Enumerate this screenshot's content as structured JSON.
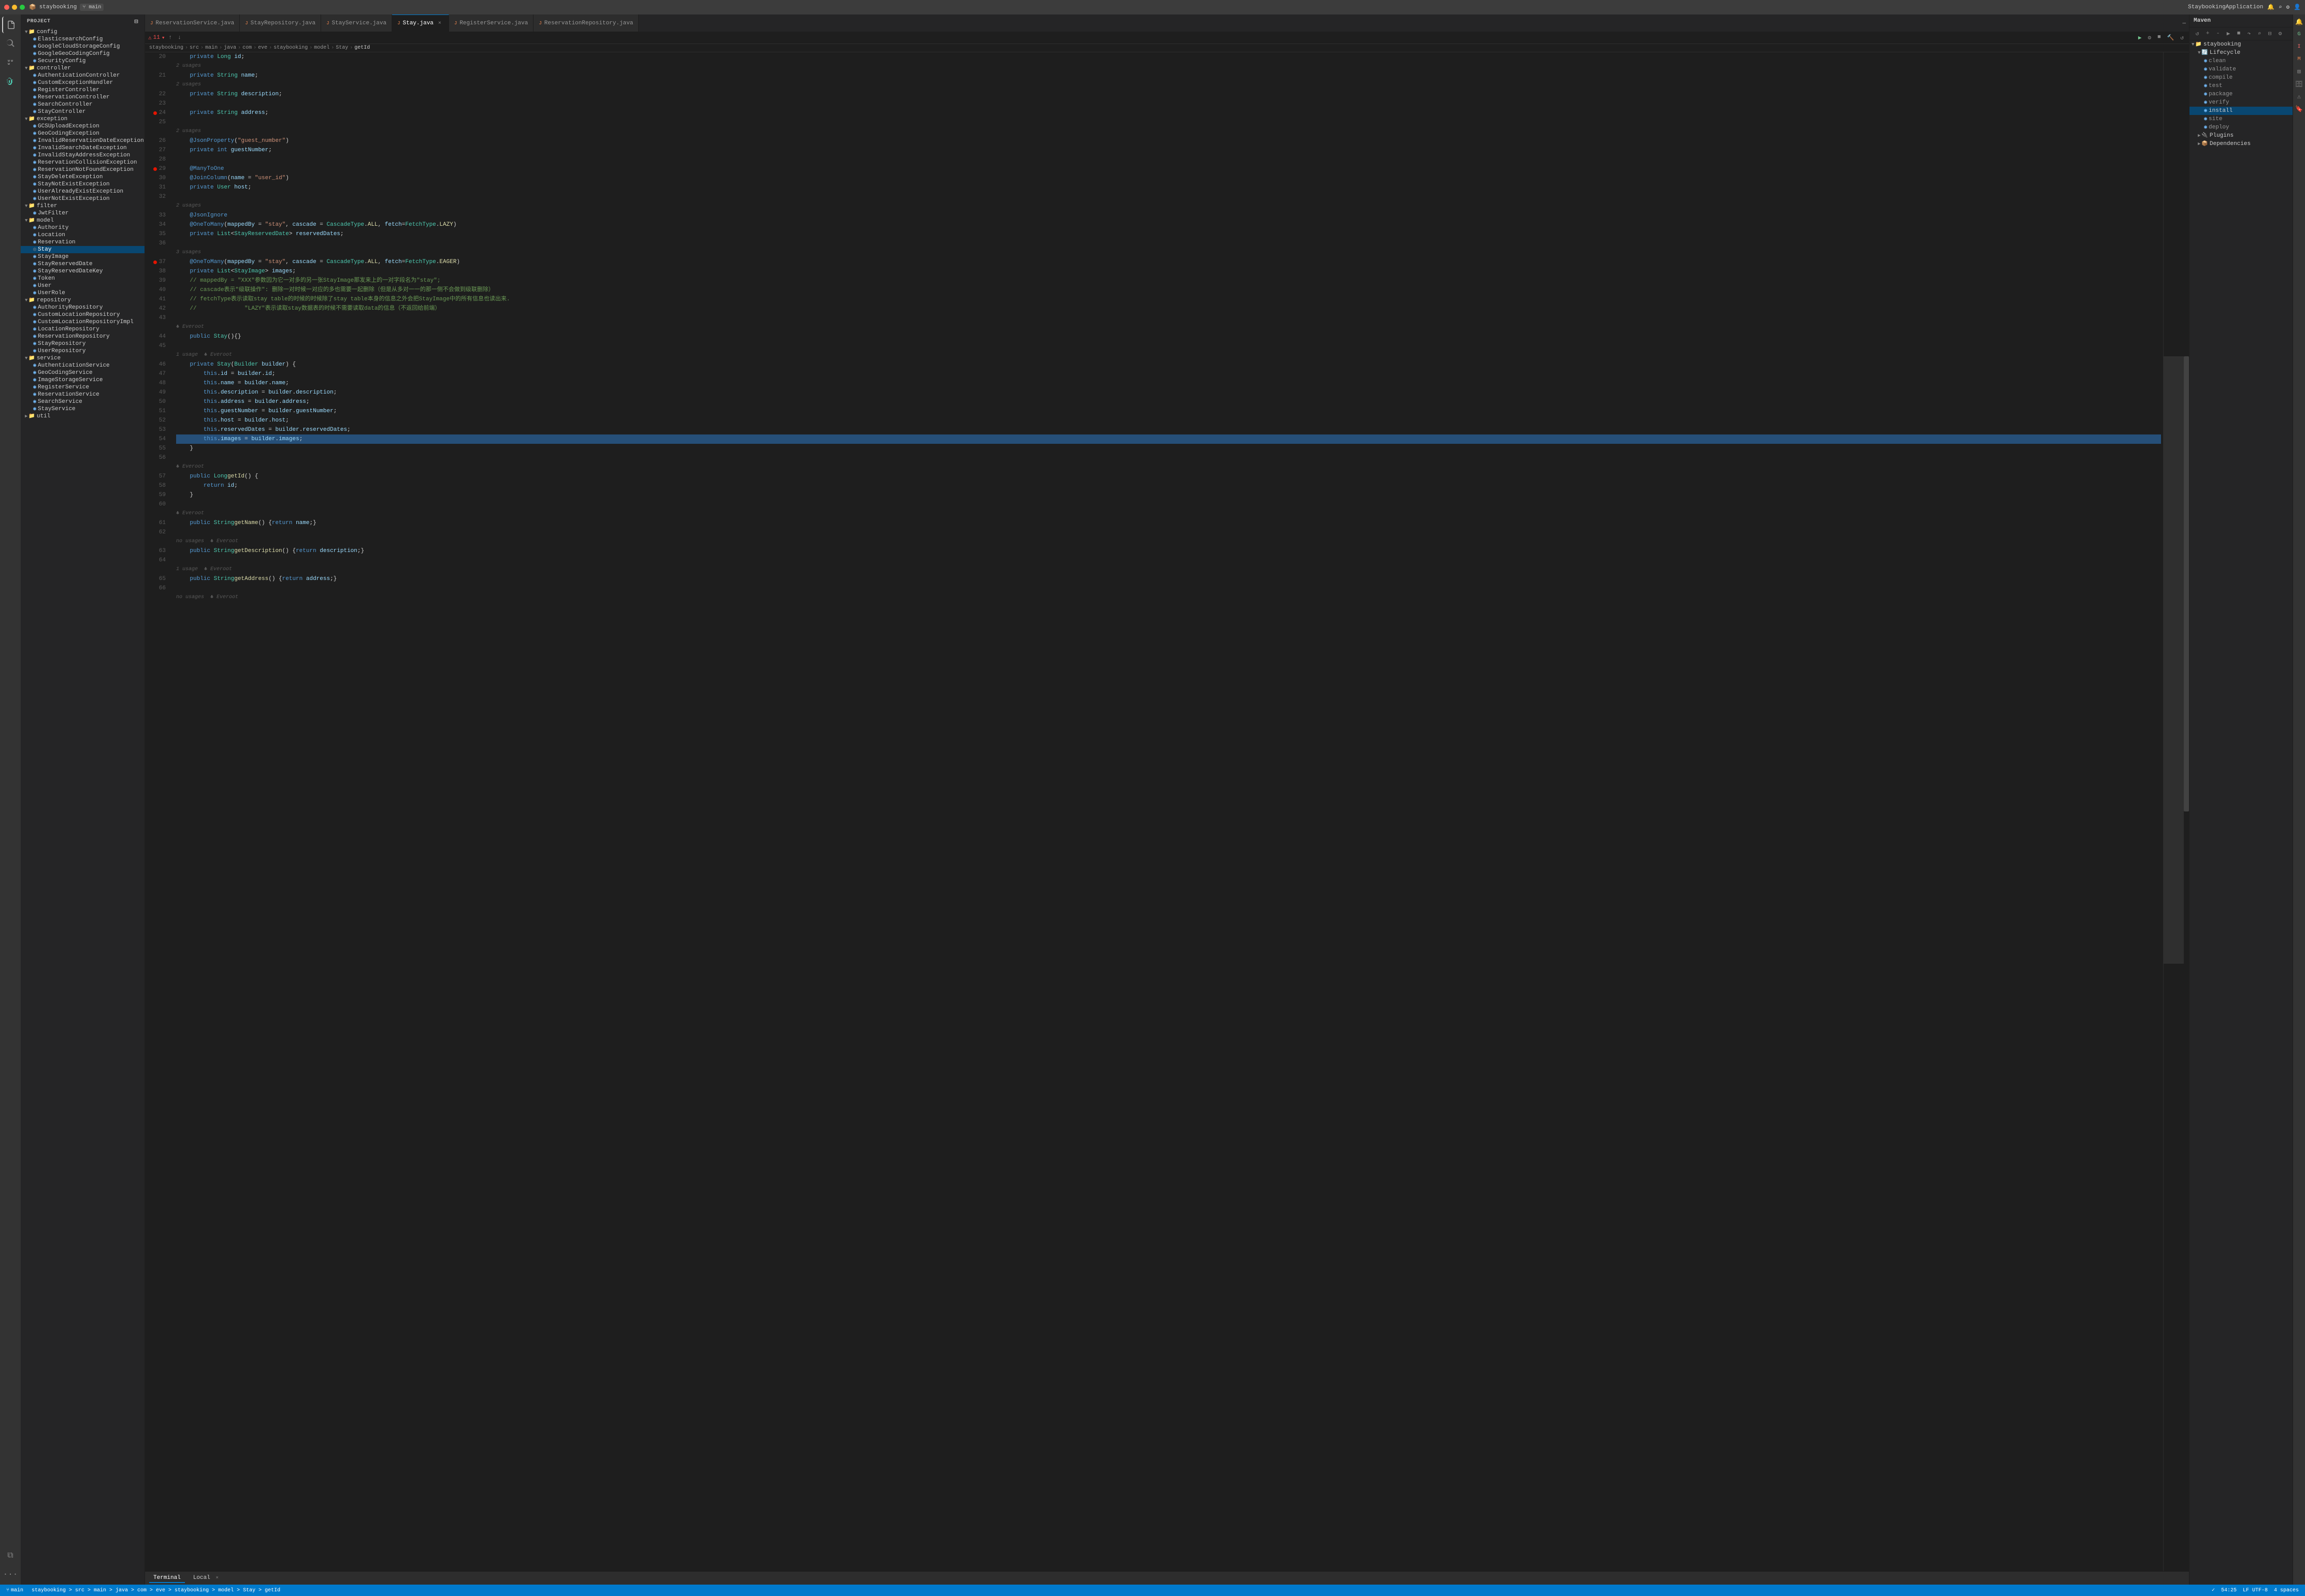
{
  "titleBar": {
    "appName": "StaybookingApplication",
    "project": "staybooking",
    "branch": "main"
  },
  "tabs": [
    {
      "label": "ReservationService.java",
      "active": false,
      "modified": false
    },
    {
      "label": "StayRepository.java",
      "active": false,
      "modified": false
    },
    {
      "label": "StayService.java",
      "active": false,
      "modified": false
    },
    {
      "label": "Stay.java",
      "active": true,
      "modified": false
    },
    {
      "label": "RegisterService.java",
      "active": false,
      "modified": false
    },
    {
      "label": "ReservationRepository.java",
      "active": false,
      "modified": false
    }
  ],
  "sidebar": {
    "title": "Project",
    "tree": [
      {
        "label": "config",
        "type": "folder",
        "depth": 1,
        "expanded": true
      },
      {
        "label": "ElasticsearchConfig",
        "type": "file",
        "depth": 2
      },
      {
        "label": "GoogleCloudStorageConfig",
        "type": "file",
        "depth": 2
      },
      {
        "label": "GoogleGeoCodingConfig",
        "type": "file",
        "depth": 2
      },
      {
        "label": "SecurityConfig",
        "type": "file",
        "depth": 2
      },
      {
        "label": "controller",
        "type": "folder",
        "depth": 1,
        "expanded": true
      },
      {
        "label": "AuthenticationController",
        "type": "file",
        "depth": 2
      },
      {
        "label": "CustomExceptionHandler",
        "type": "file",
        "depth": 2
      },
      {
        "label": "RegisterController",
        "type": "file",
        "depth": 2
      },
      {
        "label": "ReservationController",
        "type": "file",
        "depth": 2
      },
      {
        "label": "SearchController",
        "type": "file",
        "depth": 2
      },
      {
        "label": "StayController",
        "type": "file",
        "depth": 2
      },
      {
        "label": "exception",
        "type": "folder",
        "depth": 1,
        "expanded": true
      },
      {
        "label": "GCSUploadException",
        "type": "file",
        "depth": 2
      },
      {
        "label": "GeoCodingException",
        "type": "file",
        "depth": 2
      },
      {
        "label": "InvalidReservationDateException",
        "type": "file",
        "depth": 2
      },
      {
        "label": "InvalidSearchDateException",
        "type": "file",
        "depth": 2
      },
      {
        "label": "InvalidStayAddressException",
        "type": "file",
        "depth": 2
      },
      {
        "label": "ReservationCollisionException",
        "type": "file",
        "depth": 2
      },
      {
        "label": "ReservationNotFoundException",
        "type": "file",
        "depth": 2
      },
      {
        "label": "StayDeleteException",
        "type": "file",
        "depth": 2
      },
      {
        "label": "StayNotExistException",
        "type": "file",
        "depth": 2
      },
      {
        "label": "UserAlreadyExistException",
        "type": "file",
        "depth": 2
      },
      {
        "label": "UserNotExistException",
        "type": "file",
        "depth": 2
      },
      {
        "label": "filter",
        "type": "folder",
        "depth": 1,
        "expanded": true
      },
      {
        "label": "JwtFilter",
        "type": "file",
        "depth": 2
      },
      {
        "label": "model",
        "type": "folder",
        "depth": 1,
        "expanded": true
      },
      {
        "label": "Authority",
        "type": "file",
        "depth": 2
      },
      {
        "label": "Location",
        "type": "file",
        "depth": 2
      },
      {
        "label": "Reservation",
        "type": "file",
        "depth": 2
      },
      {
        "label": "Stay",
        "type": "file",
        "depth": 2,
        "selected": true
      },
      {
        "label": "StayImage",
        "type": "file",
        "depth": 2
      },
      {
        "label": "StayReservedDate",
        "type": "file",
        "depth": 2
      },
      {
        "label": "StayReservedDateKey",
        "type": "file",
        "depth": 2
      },
      {
        "label": "Token",
        "type": "file",
        "depth": 2
      },
      {
        "label": "User",
        "type": "file",
        "depth": 2
      },
      {
        "label": "UserRole",
        "type": "file",
        "depth": 2
      },
      {
        "label": "repository",
        "type": "folder",
        "depth": 1,
        "expanded": true
      },
      {
        "label": "AuthorityRepository",
        "type": "file",
        "depth": 2
      },
      {
        "label": "CustomLocationRepository",
        "type": "file",
        "depth": 2
      },
      {
        "label": "CustomLocationRepositoryImpl",
        "type": "file",
        "depth": 2
      },
      {
        "label": "LocationRepository",
        "type": "file",
        "depth": 2
      },
      {
        "label": "ReservationRepository",
        "type": "file",
        "depth": 2
      },
      {
        "label": "StayRepository",
        "type": "file",
        "depth": 2
      },
      {
        "label": "UserRepository",
        "type": "file",
        "depth": 2
      },
      {
        "label": "service",
        "type": "folder",
        "depth": 1,
        "expanded": true
      },
      {
        "label": "AuthenticationService",
        "type": "file",
        "depth": 2
      },
      {
        "label": "GeoCodingService",
        "type": "file",
        "depth": 2
      },
      {
        "label": "ImageStorageService",
        "type": "file",
        "depth": 2
      },
      {
        "label": "RegisterService",
        "type": "file",
        "depth": 2
      },
      {
        "label": "ReservationService",
        "type": "file",
        "depth": 2
      },
      {
        "label": "SearchService",
        "type": "file",
        "depth": 2
      },
      {
        "label": "StayService",
        "type": "file",
        "depth": 2
      },
      {
        "label": "util",
        "type": "folder",
        "depth": 1,
        "expanded": false
      }
    ]
  },
  "maven": {
    "title": "Maven",
    "tree": [
      {
        "label": "staybooking",
        "type": "folder",
        "depth": 0,
        "expanded": true
      },
      {
        "label": "Lifecycle",
        "type": "folder",
        "depth": 1,
        "expanded": true
      },
      {
        "label": "clean",
        "type": "leaf",
        "depth": 2
      },
      {
        "label": "validate",
        "type": "leaf",
        "depth": 2
      },
      {
        "label": "compile",
        "type": "leaf",
        "depth": 2
      },
      {
        "label": "test",
        "type": "leaf",
        "depth": 2
      },
      {
        "label": "package",
        "type": "leaf",
        "depth": 2
      },
      {
        "label": "verify",
        "type": "leaf",
        "depth": 2
      },
      {
        "label": "install",
        "type": "leaf",
        "depth": 2,
        "selected": true
      },
      {
        "label": "site",
        "type": "leaf",
        "depth": 2
      },
      {
        "label": "deploy",
        "type": "leaf",
        "depth": 2
      },
      {
        "label": "Plugins",
        "type": "folder",
        "depth": 1,
        "expanded": false
      },
      {
        "label": "Dependencies",
        "type": "folder",
        "depth": 1,
        "expanded": false
      }
    ]
  },
  "codeLines": [
    {
      "num": 20,
      "usages": "",
      "breakpoint": false,
      "code": "    private Long id;"
    },
    {
      "num": "",
      "usages": "2 usages",
      "breakpoint": false,
      "code": ""
    },
    {
      "num": 21,
      "usages": "",
      "breakpoint": false,
      "code": "    private String name;"
    },
    {
      "num": "",
      "usages": "2 usages",
      "breakpoint": false,
      "code": ""
    },
    {
      "num": 22,
      "usages": "",
      "breakpoint": false,
      "code": "    private String description;"
    },
    {
      "num": 23,
      "usages": "",
      "breakpoint": false,
      "code": ""
    },
    {
      "num": 24,
      "usages": "",
      "breakpoint": true,
      "code": "    private String address;"
    },
    {
      "num": 25,
      "usages": "",
      "breakpoint": false,
      "code": ""
    },
    {
      "num": "",
      "usages": "2 usages",
      "breakpoint": false,
      "code": ""
    },
    {
      "num": 26,
      "usages": "",
      "breakpoint": false,
      "code": "    @JsonProperty(\"guest_number\")"
    },
    {
      "num": 27,
      "usages": "",
      "breakpoint": false,
      "code": "    private int guestNumber;"
    },
    {
      "num": 28,
      "usages": "",
      "breakpoint": false,
      "code": ""
    },
    {
      "num": 29,
      "usages": "",
      "breakpoint": true,
      "code": "    @ManyToOne"
    },
    {
      "num": 30,
      "usages": "",
      "breakpoint": false,
      "code": "    @JoinColumn(name = \"user_id\")"
    },
    {
      "num": 31,
      "usages": "",
      "breakpoint": false,
      "code": "    private User host;"
    },
    {
      "num": 32,
      "usages": "",
      "breakpoint": false,
      "code": ""
    },
    {
      "num": "",
      "usages": "2 usages",
      "breakpoint": false,
      "code": ""
    },
    {
      "num": 33,
      "usages": "",
      "breakpoint": false,
      "code": "    @JsonIgnore"
    },
    {
      "num": 34,
      "usages": "",
      "breakpoint": false,
      "code": "    @OneToMany(mappedBy = \"stay\", cascade = CascadeType.ALL, fetch=FetchType.LAZY)"
    },
    {
      "num": 35,
      "usages": "",
      "breakpoint": false,
      "code": "    private List<StayReservedDate> reservedDates;"
    },
    {
      "num": 36,
      "usages": "",
      "breakpoint": false,
      "code": ""
    },
    {
      "num": "",
      "usages": "3 usages",
      "breakpoint": false,
      "code": ""
    },
    {
      "num": 37,
      "usages": "",
      "breakpoint": true,
      "code": "    @OneToMany(mappedBy = \"stay\", cascade = CascadeType.ALL, fetch=FetchType.EAGER)"
    },
    {
      "num": 38,
      "usages": "",
      "breakpoint": false,
      "code": "    private List<StayImage> images;"
    },
    {
      "num": 39,
      "usages": "",
      "breakpoint": false,
      "code": "    // mappedBy = \"XXX\"参数因为它一对多的另一张StayImage那发来上的一对字段名为\"stay\";"
    },
    {
      "num": 40,
      "usages": "",
      "breakpoint": false,
      "code": "    // cascade表示\"级联操作\": 删除一对时候一对应的多也需要一起删除（但是从多对一一的那一侧不会做到级联删除）"
    },
    {
      "num": 41,
      "usages": "",
      "breakpoint": false,
      "code": "    // fetchType表示读取stay table的时候的时候除了stay table本身的信息之外会把StayImage中的所有信息也读出来."
    },
    {
      "num": 42,
      "usages": "",
      "breakpoint": false,
      "code": "    //              \"LAZY\"表示读取stay数据表的时候不需要读取data的信息（不返回给前端）"
    },
    {
      "num": 43,
      "usages": "",
      "breakpoint": false,
      "code": ""
    },
    {
      "num": "",
      "usages": "♣ Everoot",
      "breakpoint": false,
      "code": ""
    },
    {
      "num": 44,
      "usages": "",
      "breakpoint": false,
      "code": "    public Stay(){}"
    },
    {
      "num": 45,
      "usages": "",
      "breakpoint": false,
      "code": ""
    },
    {
      "num": "",
      "usages": "1 usage  ♣ Everoot",
      "breakpoint": false,
      "code": ""
    },
    {
      "num": 46,
      "usages": "",
      "breakpoint": false,
      "code": "    private Stay(Builder builder) {"
    },
    {
      "num": 47,
      "usages": "",
      "breakpoint": false,
      "code": "        this.id = builder.id;"
    },
    {
      "num": 48,
      "usages": "",
      "breakpoint": false,
      "code": "        this.name = builder.name;"
    },
    {
      "num": 49,
      "usages": "",
      "breakpoint": false,
      "code": "        this.description = builder.description;"
    },
    {
      "num": 50,
      "usages": "",
      "breakpoint": false,
      "code": "        this.address = builder.address;"
    },
    {
      "num": 51,
      "usages": "",
      "breakpoint": false,
      "code": "        this.guestNumber = builder.guestNumber;"
    },
    {
      "num": 52,
      "usages": "",
      "breakpoint": false,
      "code": "        this.host = builder.host;"
    },
    {
      "num": 53,
      "usages": "",
      "breakpoint": false,
      "code": "        this.reservedDates = builder.reservedDates;"
    },
    {
      "num": 54,
      "usages": "",
      "breakpoint": false,
      "code": "        this.images = builder.images;"
    },
    {
      "num": 55,
      "usages": "",
      "breakpoint": false,
      "code": "    }"
    },
    {
      "num": 56,
      "usages": "",
      "breakpoint": false,
      "code": ""
    },
    {
      "num": "",
      "usages": "♣ Everoot",
      "breakpoint": false,
      "code": ""
    },
    {
      "num": 57,
      "usages": "",
      "breakpoint": false,
      "code": "    public Long getId() {",
      "highlight": true
    },
    {
      "num": 58,
      "usages": "",
      "breakpoint": false,
      "code": "        return id;"
    },
    {
      "num": 59,
      "usages": "",
      "breakpoint": false,
      "code": "    }"
    },
    {
      "num": 60,
      "usages": "",
      "breakpoint": false,
      "code": ""
    },
    {
      "num": "",
      "usages": "♣ Everoot",
      "breakpoint": false,
      "code": ""
    },
    {
      "num": 61,
      "usages": "",
      "breakpoint": false,
      "code": "    public String getName() {return name;}"
    },
    {
      "num": 62,
      "usages": "",
      "breakpoint": false,
      "code": ""
    },
    {
      "num": "",
      "usages": "no usages  ♣ Everoot",
      "breakpoint": false,
      "code": ""
    },
    {
      "num": 63,
      "usages": "",
      "breakpoint": false,
      "code": "    public String getDescription() {return description;}"
    },
    {
      "num": 64,
      "usages": "",
      "breakpoint": false,
      "code": ""
    },
    {
      "num": "",
      "usages": "1 usage  ♣ Everoot",
      "breakpoint": false,
      "code": ""
    },
    {
      "num": 65,
      "usages": "",
      "breakpoint": false,
      "code": "    public String getAddress() {return address;}"
    },
    {
      "num": 66,
      "usages": "",
      "breakpoint": false,
      "code": ""
    },
    {
      "num": "",
      "usages": "no usages  ♣ Everoot",
      "breakpoint": false,
      "code": ""
    }
  ],
  "statusBar": {
    "path": "staybooking > src > main > java > com > eve > staybooking > model > Stay > getId",
    "line": "54:25",
    "encoding": "LF  UTF-8",
    "indent": "4 spaces"
  },
  "terminal": {
    "tabs": [
      {
        "label": "Terminal",
        "active": true
      },
      {
        "label": "Local",
        "active": false
      }
    ]
  }
}
